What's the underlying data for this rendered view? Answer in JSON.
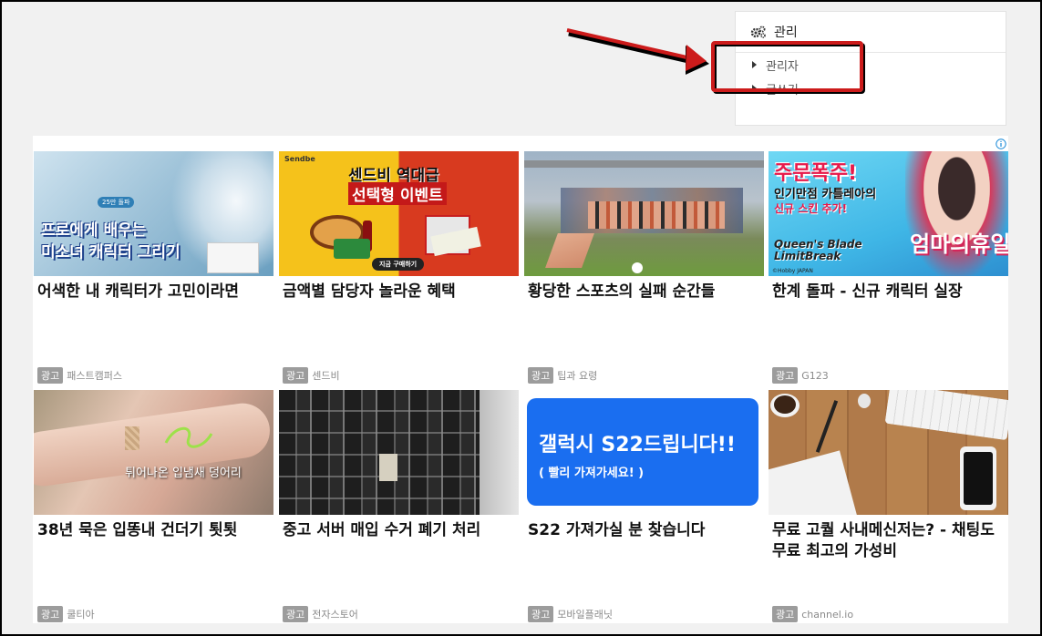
{
  "sidebar": {
    "title": "관리",
    "items": [
      {
        "label": "관리자"
      },
      {
        "label": "글쓰기"
      }
    ]
  },
  "ads": {
    "badge_label": "광고",
    "cards": [
      {
        "title": "어색한 내 캐릭터가 고민이라면",
        "brand": "패스트캠퍼스",
        "image_text": {
          "line1": "프로에게 배우는",
          "line2": "미소녀 캐릭터 그리기",
          "tag": "25만 돌파"
        }
      },
      {
        "title": "금액별 담당자 놀라운 혜택",
        "brand": "센드비",
        "image_text": {
          "brand": "Sendbe",
          "line1": "센드비 역대급",
          "line2": "선택형 이벤트",
          "cta": "지금 구매하기"
        }
      },
      {
        "title": "황당한 스포츠의 실패 순간들",
        "brand": "팁과 요령"
      },
      {
        "title": "한계 돌파 - 신규 캐릭터 실장",
        "brand": "G123",
        "image_text": {
          "line1": "주문폭주!",
          "line2": "인기만점 카틀레아의",
          "line3": "신규 스킨 추가!",
          "logo": "Queen's Blade LimitBreak",
          "tag": "엄마의휴일",
          "copyright": "©Hobby JAPAN"
        }
      },
      {
        "title": "38년 묵은 입똥내 건더기 툇툇",
        "brand": "쿨티아",
        "image_text": {
          "caption": "튀어나온 입냄새 덩어리"
        }
      },
      {
        "title": "중고 서버 매입 수거 폐기 처리",
        "brand": "전자스토어"
      },
      {
        "title": "S22 가져가실 분 찾습니다",
        "brand": "모바일플래닛",
        "image_text": {
          "line1": "갤럭시 S22드립니다!!",
          "line2": "( 빨리 가져가세요! )"
        }
      },
      {
        "title": "무료 고퀄 사내메신저는? - 채팅도 무료 최고의 가성비",
        "brand": "channel.io"
      }
    ]
  },
  "colors": {
    "highlight": "#cc1b1b",
    "blue_ad": "#1a6ef0",
    "background": "#f1f1f1"
  }
}
